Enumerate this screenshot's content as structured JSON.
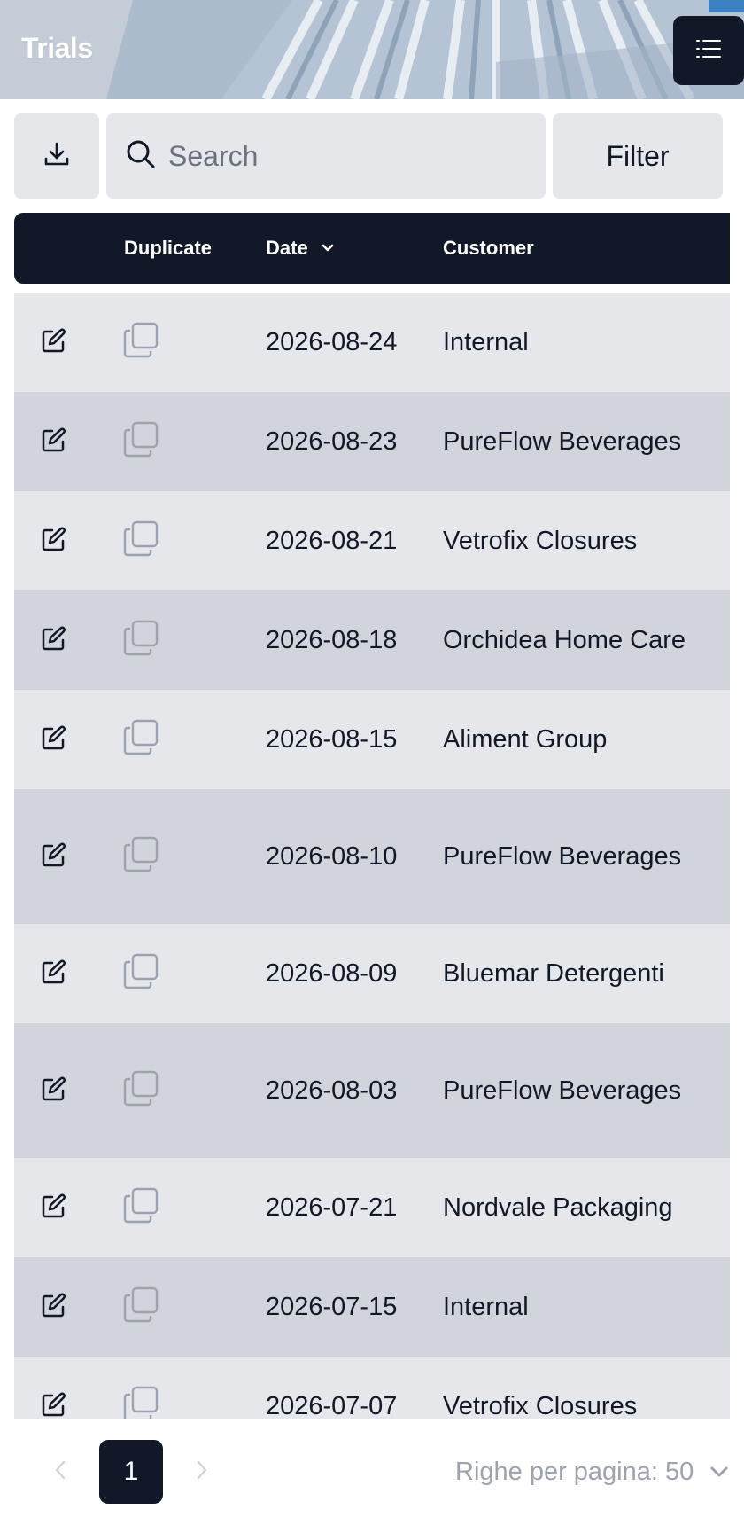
{
  "header": {
    "title": "Trials",
    "menu_icon": "list-icon"
  },
  "toolbar": {
    "download_icon": "download-icon",
    "search_icon": "search-icon",
    "search_placeholder": "Search",
    "search_value": "",
    "filter_label": "Filter"
  },
  "table": {
    "columns": {
      "edit": "",
      "duplicate": "Duplicate",
      "date": "Date",
      "customer": "Customer"
    },
    "sort_icon": "chevron-down-icon",
    "row_icons": {
      "edit": "edit-icon",
      "duplicate": "copy-icon"
    },
    "rows": [
      {
        "date": "2026-08-24",
        "customer": "Internal"
      },
      {
        "date": "2026-08-23",
        "customer": "PureFlow Beverages"
      },
      {
        "date": "2026-08-21",
        "customer": "Vetrofix Closures"
      },
      {
        "date": "2026-08-18",
        "customer": "Orchidea Home Care"
      },
      {
        "date": "2026-08-15",
        "customer": "Aliment Group"
      },
      {
        "date": "2026-08-10",
        "customer": "PureFlow Beverages"
      },
      {
        "date": "2026-08-09",
        "customer": "Bluemar Detergenti"
      },
      {
        "date": "2026-08-03",
        "customer": "PureFlow Beverages"
      },
      {
        "date": "2026-07-21",
        "customer": "Nordvale Packaging"
      },
      {
        "date": "2026-07-15",
        "customer": "Internal"
      },
      {
        "date": "2026-07-07",
        "customer": "Vetrofix Closures"
      }
    ]
  },
  "pagination": {
    "current_page": "1",
    "rows_per_page_label": "Righe per pagina:",
    "rows_per_page_value": "50",
    "prev_icon": "chevron-left-icon",
    "next_icon": "chevron-right-icon",
    "dropdown_icon": "chevron-down-icon"
  },
  "colors": {
    "dark": "#111827",
    "row_light": "#e5e7eb",
    "row_dark": "#d1d5db",
    "muted_text": "#9ca3af"
  }
}
